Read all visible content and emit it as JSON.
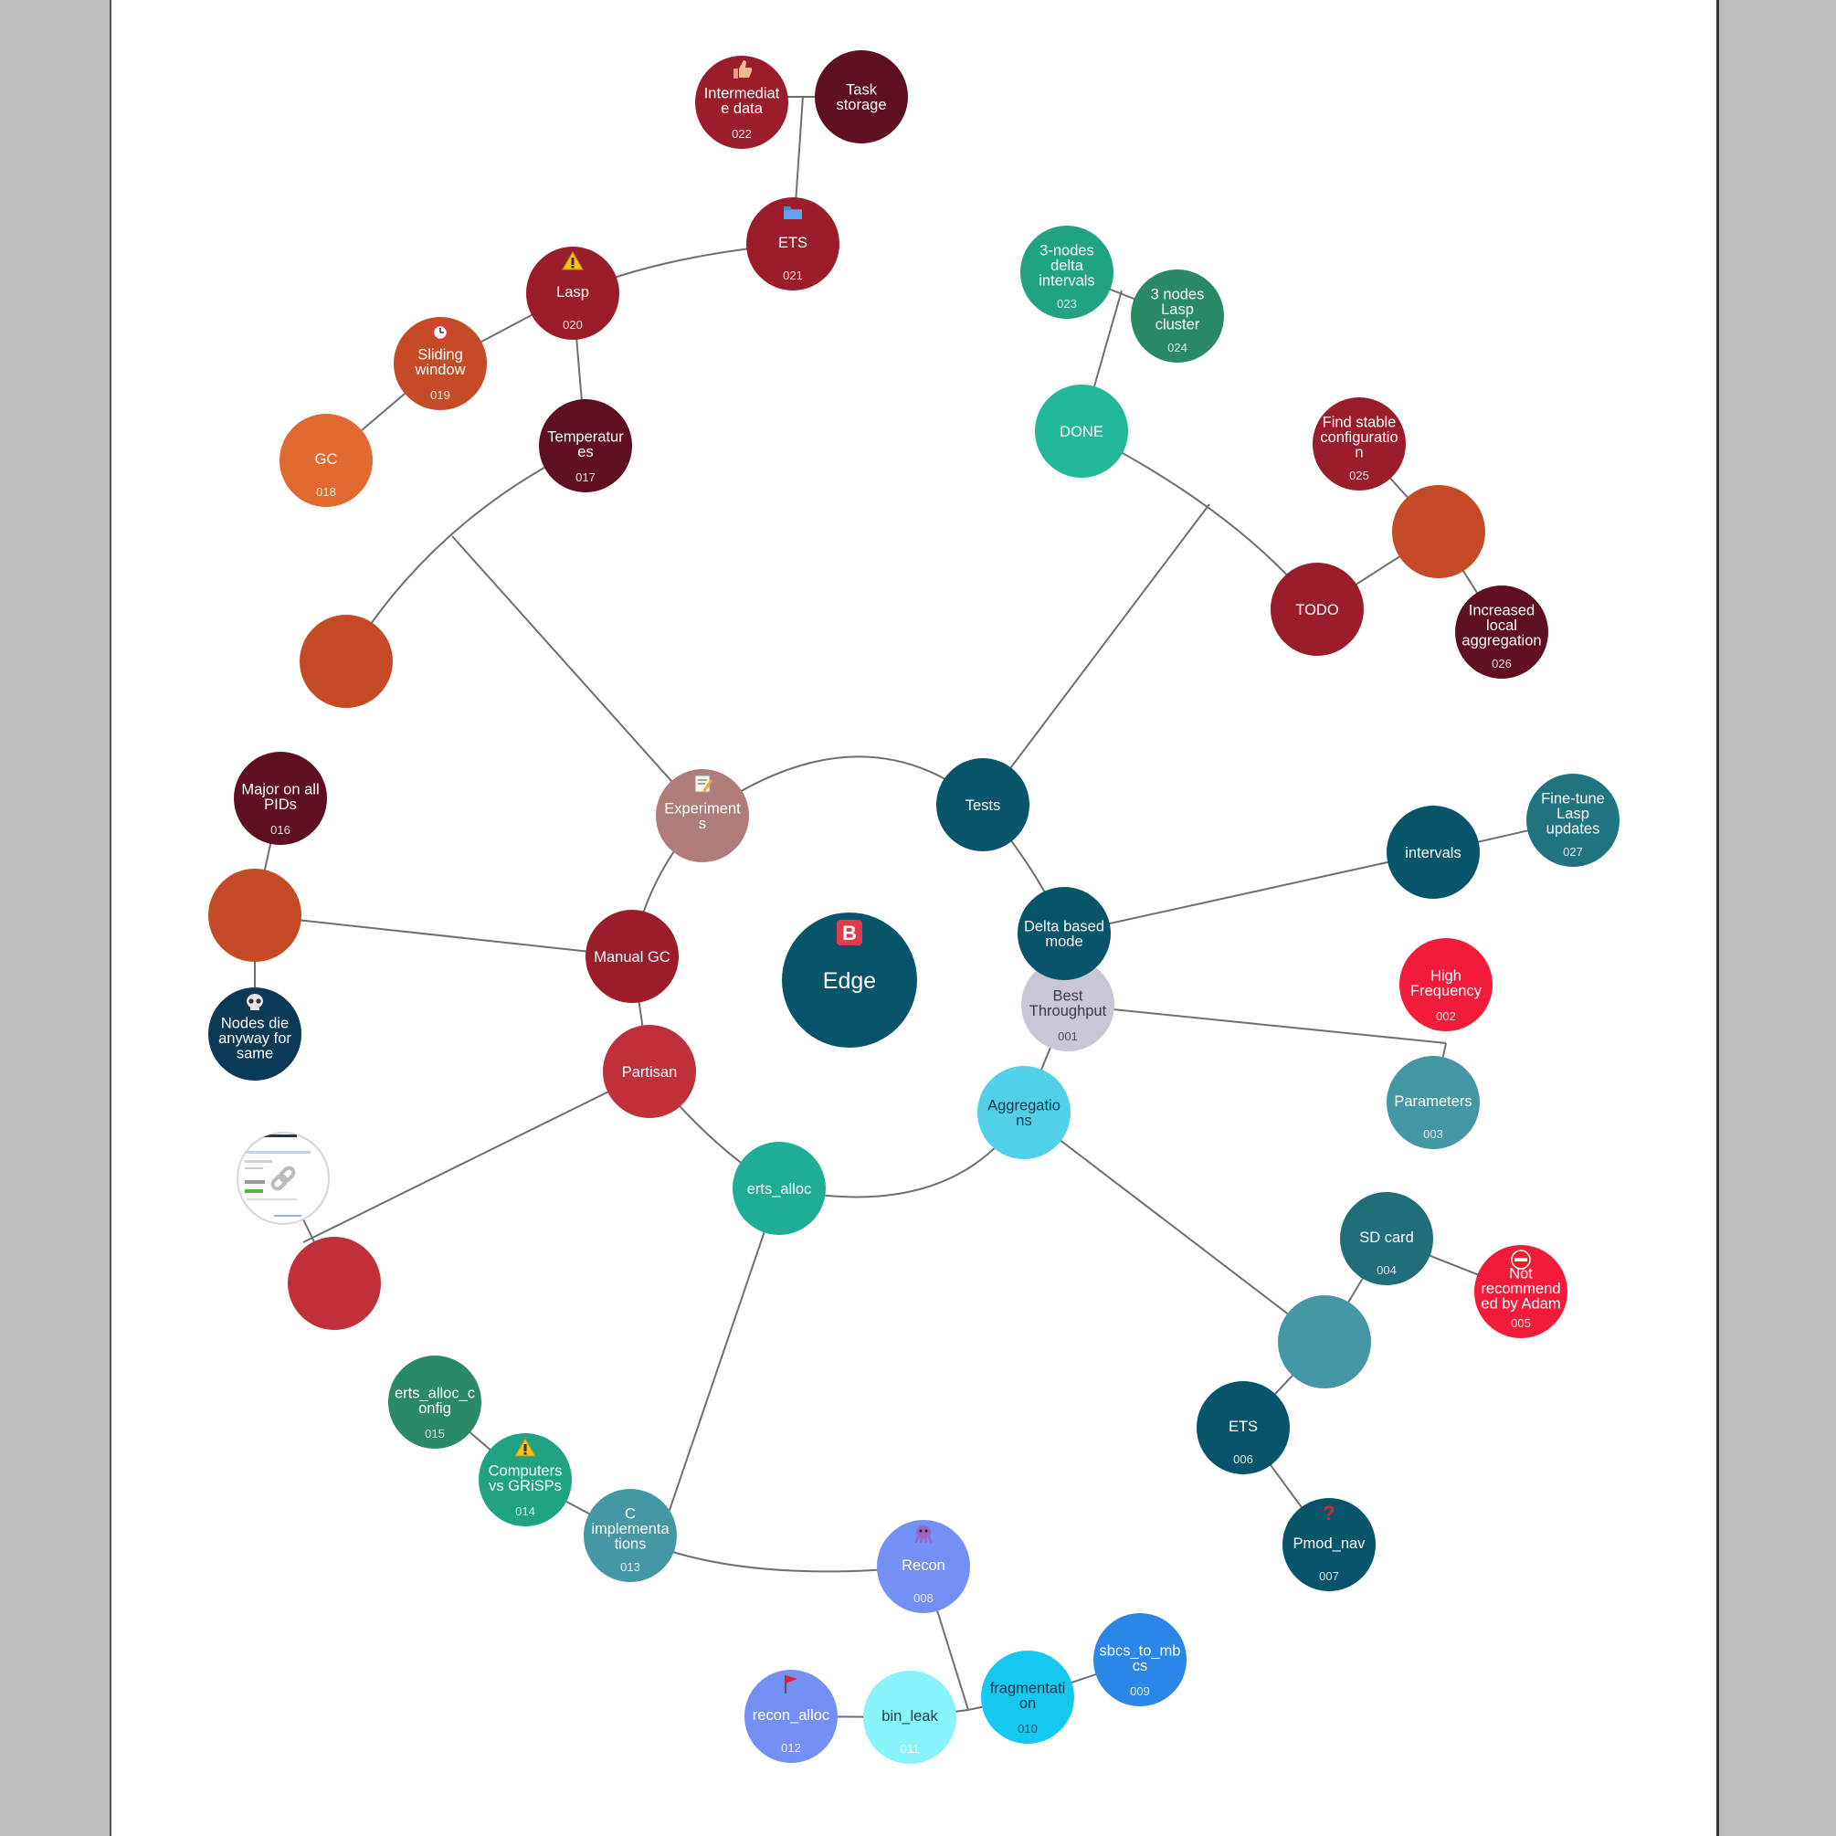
{
  "colors": {
    "link": "#6f6f6f",
    "paper": "#ffffff",
    "backdrop": "#bdbdbd"
  },
  "root": {
    "label": "Edge",
    "icon": "brand-b-icon",
    "color": "#08556b"
  },
  "nodes": [
    {
      "key": "experiments",
      "label": "Experiments",
      "lines": [
        "Experiment",
        "s"
      ],
      "color": "#b07b7b",
      "icon": "memo-icon"
    },
    {
      "key": "tests",
      "label": "Tests",
      "lines": [
        "Tests"
      ],
      "color": "#08556b"
    },
    {
      "key": "manual-gc",
      "label": "Manual GC",
      "lines": [
        "Manual GC"
      ],
      "color": "#9b1c2a"
    },
    {
      "key": "partisan",
      "label": "Partisan",
      "lines": [
        "Partisan"
      ],
      "color": "#c0303a"
    },
    {
      "key": "erts-alloc",
      "label": "erts_alloc",
      "lines": [
        "erts_alloc"
      ],
      "color": "#1fae95"
    },
    {
      "key": "aggregations",
      "label": "Aggregations",
      "lines": [
        "Aggregatio",
        "ns"
      ],
      "color": "#52d0ea",
      "text_color": "#0a3a4a"
    },
    {
      "key": "best-throughput",
      "label": "Best Throughput",
      "lines": [
        "Best",
        "Throughput"
      ],
      "number": "001",
      "color": "#c9c6d6",
      "text_color": "#3a3a4a"
    },
    {
      "key": "delta-based-mode",
      "label": "Delta based mode",
      "lines": [
        "Delta based",
        "mode"
      ],
      "color": "#08556b"
    },
    {
      "key": "done",
      "label": "DONE",
      "lines": [
        "DONE"
      ],
      "color": "#22b89a"
    },
    {
      "key": "todo",
      "label": "TODO",
      "lines": [
        "TODO"
      ],
      "color": "#9b1c2a"
    },
    {
      "key": "nodes-delta-intervals",
      "label": "3-nodes delta intervals",
      "lines": [
        "3-nodes",
        "delta",
        "intervals"
      ],
      "number": "023",
      "color": "#1fa383"
    },
    {
      "key": "nodes-lasp-cluster",
      "label": "3  nodes Lasp cluster",
      "lines": [
        "3  nodes",
        "Lasp",
        "cluster"
      ],
      "number": "024",
      "color": "#2a8a66"
    },
    {
      "key": "find-stable-configuration",
      "label": "Find stable configuration",
      "lines": [
        "Find stable",
        "configuratio",
        "n"
      ],
      "number": "025",
      "color": "#9b1c2a"
    },
    {
      "key": "todo-hub",
      "label": "",
      "lines": [],
      "color": "#c54a26"
    },
    {
      "key": "increased-local-aggregation",
      "label": "Increased local aggregation",
      "lines": [
        "Increased",
        "local",
        "aggregation"
      ],
      "number": "026",
      "color": "#5f0f22"
    },
    {
      "key": "intervals",
      "label": "intervals",
      "lines": [
        "intervals"
      ],
      "color": "#08556b"
    },
    {
      "key": "fine-tune-lasp-updates",
      "label": "Fine-tune Lasp updates",
      "lines": [
        "Fine-tune",
        "Lasp",
        "updates"
      ],
      "number": "027",
      "color": "#1f7480"
    },
    {
      "key": "high-frequency",
      "label": "High Frequency",
      "lines": [
        "High",
        "Frequency"
      ],
      "number": "002",
      "color": "#f21c3a"
    },
    {
      "key": "parameters",
      "label": "Parameters",
      "lines": [
        "Parameters"
      ],
      "number": "003",
      "color": "#4597a3"
    },
    {
      "key": "aggregations-hub",
      "label": "",
      "lines": [],
      "color": "#4597a3"
    },
    {
      "key": "sd-card",
      "label": "SD card",
      "lines": [
        "SD card"
      ],
      "number": "004",
      "color": "#1f6e7a"
    },
    {
      "key": "not-recommended",
      "label": "Not recommended by Adam",
      "lines": [
        "Not",
        "recommend",
        "ed by Adam"
      ],
      "number": "005",
      "color": "#f21c3a",
      "icon": "no-entry-icon"
    },
    {
      "key": "ets-006",
      "label": "ETS",
      "lines": [
        "ETS"
      ],
      "number": "006",
      "color": "#08556b"
    },
    {
      "key": "pmod-nav",
      "label": "Pmod_nav",
      "lines": [
        "Pmod_nav"
      ],
      "number": "007",
      "color": "#08556b",
      "icon": "question-icon"
    },
    {
      "key": "c-implementations",
      "label": "C implementations",
      "lines": [
        "C",
        "implementa",
        "tions"
      ],
      "number": "013",
      "color": "#4597a3"
    },
    {
      "key": "computers-vs-grisps",
      "label": "Computers vs GRiSPs",
      "lines": [
        "Computers",
        "vs GRiSPs"
      ],
      "number": "014",
      "color": "#1fa383",
      "icon": "warning-icon"
    },
    {
      "key": "erts-alloc-config",
      "label": "erts_alloc_config",
      "lines": [
        "erts_alloc_c",
        "onfig"
      ],
      "number": "015",
      "color": "#2a8a66"
    },
    {
      "key": "recon",
      "label": "Recon",
      "lines": [
        "Recon"
      ],
      "number": "008",
      "color": "#7590f5",
      "icon": "octopus-icon"
    },
    {
      "key": "fragmentation",
      "label": "fragmentation",
      "lines": [
        "fragmentati",
        "on"
      ],
      "number": "010",
      "color": "#14c8f0",
      "text_color": "#0a3a4a"
    },
    {
      "key": "sbcs-to-mbcs",
      "label": "sbcs_to_mbcs",
      "lines": [
        "sbcs_to_mb",
        "cs"
      ],
      "number": "009",
      "color": "#2b86e8"
    },
    {
      "key": "bin-leak",
      "label": "bin_leak",
      "lines": [
        "bin_leak"
      ],
      "number": "011",
      "color": "#88f3fb",
      "text_color": "#1a4450",
      "number_color": "#ffffff"
    },
    {
      "key": "recon-alloc",
      "label": "recon_alloc",
      "lines": [
        "recon_alloc"
      ],
      "number": "012",
      "color": "#7590f5",
      "icon": "flag-icon"
    },
    {
      "key": "partisan-hub",
      "label": "",
      "lines": [],
      "color": "#c0303a"
    },
    {
      "key": "partisan-screenshot",
      "label": "",
      "lines": [],
      "color": "#ffffff",
      "icon": "link-icon"
    },
    {
      "key": "manual-gc-hub",
      "label": "",
      "lines": [],
      "color": "#c54a26"
    },
    {
      "key": "major-on-all-pids",
      "label": "Major on all PIDs",
      "lines": [
        "Major on all",
        "PIDs"
      ],
      "number": "016",
      "color": "#5f0f22"
    },
    {
      "key": "nodes-die-anyway",
      "label": "Nodes die anyway for same",
      "lines": [
        "Nodes die",
        "anyway for",
        "same"
      ],
      "color": "#0b3a57",
      "icon": "skull-icon"
    },
    {
      "key": "experiments-hub",
      "label": "",
      "lines": [],
      "color": "#c54a26"
    },
    {
      "key": "temperatures",
      "label": "Temperatures",
      "lines": [
        "Temperatur",
        "es"
      ],
      "number": "017",
      "color": "#5f0f22"
    },
    {
      "key": "lasp",
      "label": "Lasp",
      "lines": [
        "Lasp"
      ],
      "number": "020",
      "color": "#9b1c2a",
      "icon": "warning-icon"
    },
    {
      "key": "sliding-window",
      "label": "Sliding window",
      "lines": [
        "Sliding",
        "window"
      ],
      "number": "019",
      "color": "#c54a26",
      "icon": "alarm-clock-icon"
    },
    {
      "key": "gc",
      "label": "GC",
      "lines": [
        "GC"
      ],
      "number": "018",
      "color": "#e06a30"
    },
    {
      "key": "ets-021",
      "label": "ETS",
      "lines": [
        "ETS"
      ],
      "number": "021",
      "color": "#9b1c2a",
      "icon": "folder-icon"
    },
    {
      "key": "intermediate-data",
      "label": "Intermediate data",
      "lines": [
        "Intermediat",
        "e data"
      ],
      "number": "022",
      "color": "#9b1c2a",
      "icon": "thumbs-up-icon"
    },
    {
      "key": "task-storage",
      "label": "Task storage",
      "lines": [
        "Task",
        "storage"
      ],
      "color": "#5f0f22"
    }
  ]
}
